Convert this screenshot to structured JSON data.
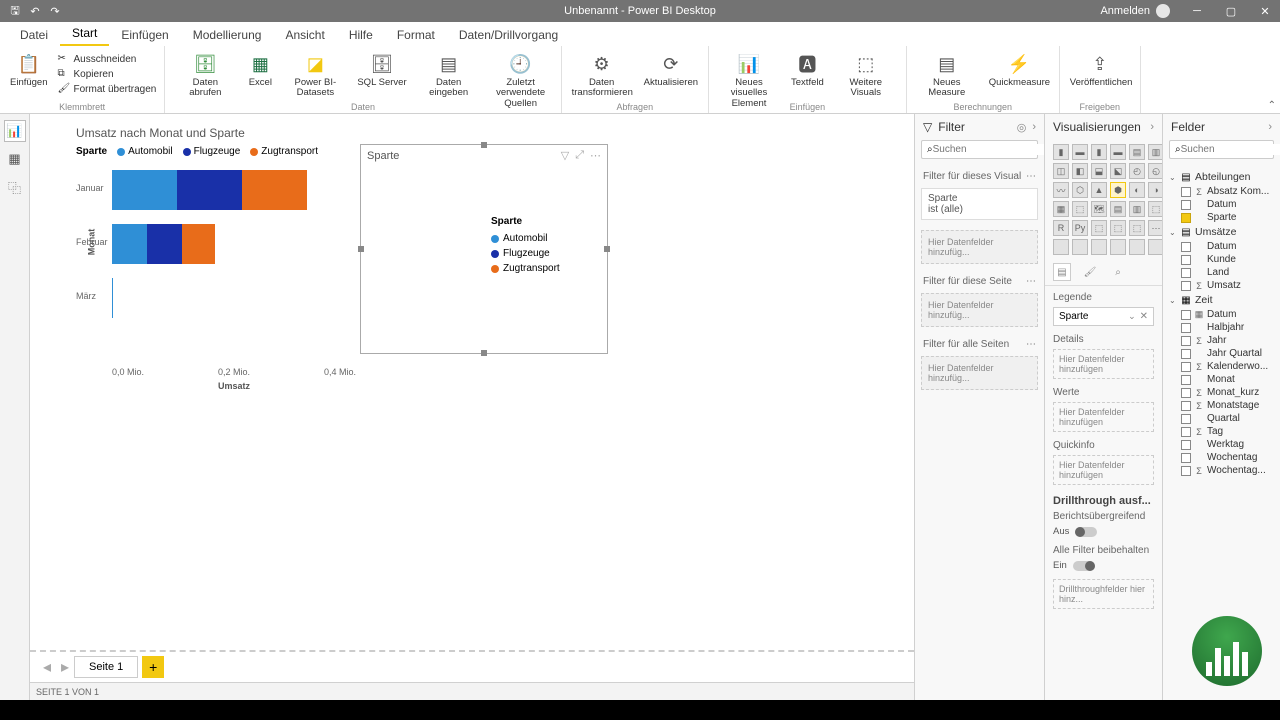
{
  "titlebar": {
    "title": "Unbenannt - Power BI Desktop",
    "signin": "Anmelden"
  },
  "tabs": {
    "file": "Datei",
    "start": "Start",
    "insert": "Einfügen",
    "model": "Modellierung",
    "view": "Ansicht",
    "help": "Hilfe",
    "format": "Format",
    "drill": "Daten/Drillvorgang"
  },
  "ribbon": {
    "clipboard": {
      "label": "Klemmbrett",
      "paste": "Einfügen",
      "cut": "Ausschneiden",
      "copy": "Kopieren",
      "fmt": "Format übertragen"
    },
    "data": {
      "label": "Daten",
      "get": "Daten abrufen",
      "excel": "Excel",
      "pbi": "Power BI-Datasets",
      "sql": "SQL Server",
      "enter": "Daten eingeben",
      "recent": "Zuletzt verwendete Quellen"
    },
    "queries": {
      "label": "Abfragen",
      "transform": "Daten transformieren",
      "refresh": "Aktualisieren"
    },
    "insert": {
      "label": "Einfügen",
      "visual": "Neues visuelles Element",
      "textbox": "Textfeld",
      "more": "Weitere Visuals"
    },
    "calc": {
      "label": "Berechnungen",
      "measure": "Neues Measure",
      "quick": "Quickmeasure"
    },
    "share": {
      "label": "Freigeben",
      "publish": "Veröffentlichen"
    }
  },
  "pages": {
    "page1": "Seite 1"
  },
  "status": "SEITE 1 VON 1",
  "chart_data": {
    "type": "bar",
    "orientation": "horizontal",
    "stacked": true,
    "title": "Umsatz nach Monat und Sparte",
    "legend_title": "Sparte",
    "xlabel": "Umsatz",
    "ylabel": "Monat",
    "xlim_label": [
      "0,0 Mio.",
      "0,2 Mio.",
      "0,4 Mio."
    ],
    "categories": [
      "Januar",
      "Februar",
      "März"
    ],
    "series": [
      {
        "name": "Automobil",
        "color": "#2f8fd6",
        "values": [
          0.13,
          0.07,
          0.002
        ]
      },
      {
        "name": "Flugzeuge",
        "color": "#1930a8",
        "values": [
          0.13,
          0.07,
          0
        ]
      },
      {
        "name": "Zugtransport",
        "color": "#e86c1a",
        "values": [
          0.13,
          0.065,
          0
        ]
      }
    ]
  },
  "visual2": {
    "title": "Sparte",
    "legend_title": "Sparte"
  },
  "filter": {
    "title": "Filter",
    "search_ph": "Suchen",
    "visual_label": "Filter für dieses Visual",
    "card_field": "Sparte",
    "card_value": "ist (alle)",
    "page_label": "Filter für diese Seite",
    "all_label": "Filter für alle Seiten",
    "drop": "Hier Datenfelder hinzufüg..."
  },
  "viz": {
    "title": "Visualisierungen",
    "well_legend": "Legende",
    "well_legend_field": "Sparte",
    "well_details": "Details",
    "well_values": "Werte",
    "well_tooltip": "Quickinfo",
    "drop": "Hier Datenfelder hinzufügen",
    "drill_head": "Drillthrough ausf...",
    "cross": "Berichtsübergreifend",
    "cross_state": "Aus",
    "keep": "Alle Filter beibehalten",
    "keep_state": "Ein",
    "drill_drop": "Drillthroughfelder hier hinz..."
  },
  "fields": {
    "title": "Felder",
    "search_ph": "Suchen",
    "tables": [
      {
        "name": "Abteilungen",
        "icon": "tbl",
        "expanded": true,
        "fields": [
          {
            "name": "Absatz Kom...",
            "sig": "Σ",
            "checked": false
          },
          {
            "name": "Datum",
            "sig": "",
            "checked": false
          },
          {
            "name": "Sparte",
            "sig": "",
            "checked": true
          }
        ]
      },
      {
        "name": "Umsätze",
        "icon": "tbl",
        "expanded": true,
        "fields": [
          {
            "name": "Datum",
            "sig": "",
            "checked": false
          },
          {
            "name": "Kunde",
            "sig": "",
            "checked": false
          },
          {
            "name": "Land",
            "sig": "",
            "checked": false
          },
          {
            "name": "Umsatz",
            "sig": "Σ",
            "checked": false
          }
        ]
      },
      {
        "name": "Zeit",
        "icon": "cal",
        "expanded": true,
        "fields": [
          {
            "name": "Datum",
            "sig": "▦",
            "checked": false
          },
          {
            "name": "Halbjahr",
            "sig": "",
            "checked": false
          },
          {
            "name": "Jahr",
            "sig": "Σ",
            "checked": false
          },
          {
            "name": "Jahr Quartal",
            "sig": "",
            "checked": false
          },
          {
            "name": "Kalenderwo...",
            "sig": "Σ",
            "checked": false
          },
          {
            "name": "Monat",
            "sig": "",
            "checked": false
          },
          {
            "name": "Monat_kurz",
            "sig": "Σ",
            "checked": false
          },
          {
            "name": "Monatstage",
            "sig": "Σ",
            "checked": false
          },
          {
            "name": "Quartal",
            "sig": "",
            "checked": false
          },
          {
            "name": "Tag",
            "sig": "Σ",
            "checked": false
          },
          {
            "name": "Werktag",
            "sig": "",
            "checked": false
          },
          {
            "name": "Wochentag",
            "sig": "",
            "checked": false
          },
          {
            "name": "Wochentag...",
            "sig": "Σ",
            "checked": false
          }
        ]
      }
    ]
  }
}
